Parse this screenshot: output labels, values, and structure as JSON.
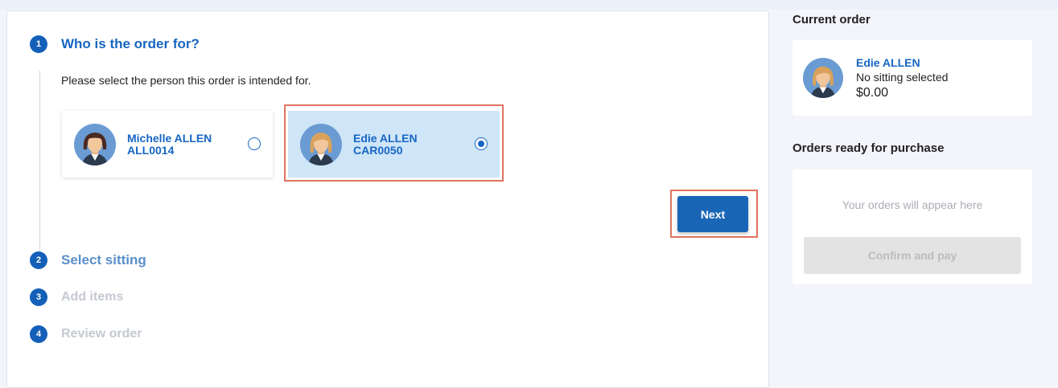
{
  "steps": [
    {
      "num": "1",
      "title": "Who is the order for?"
    },
    {
      "num": "2",
      "title": "Select sitting"
    },
    {
      "num": "3",
      "title": "Add items"
    },
    {
      "num": "4",
      "title": "Review order"
    }
  ],
  "instruction": "Please select the person this order is intended for.",
  "people": [
    {
      "name": "Michelle ALLEN",
      "code": "ALL0014",
      "selected": false
    },
    {
      "name": "Edie ALLEN",
      "code": "CAR0050",
      "selected": true
    }
  ],
  "next_label": "Next",
  "current_order": {
    "title": "Current order",
    "name": "Edie ALLEN",
    "sitting": "No sitting selected",
    "price": "$0.00"
  },
  "orders_ready": {
    "title": "Orders ready for purchase",
    "empty_text": "Your orders will appear here",
    "confirm_label": "Confirm and pay"
  },
  "colors": {
    "accent": "#1666c3",
    "button": "#1a66b6",
    "highlight": "#e0735e",
    "selected_card": "#cfe5f8"
  }
}
